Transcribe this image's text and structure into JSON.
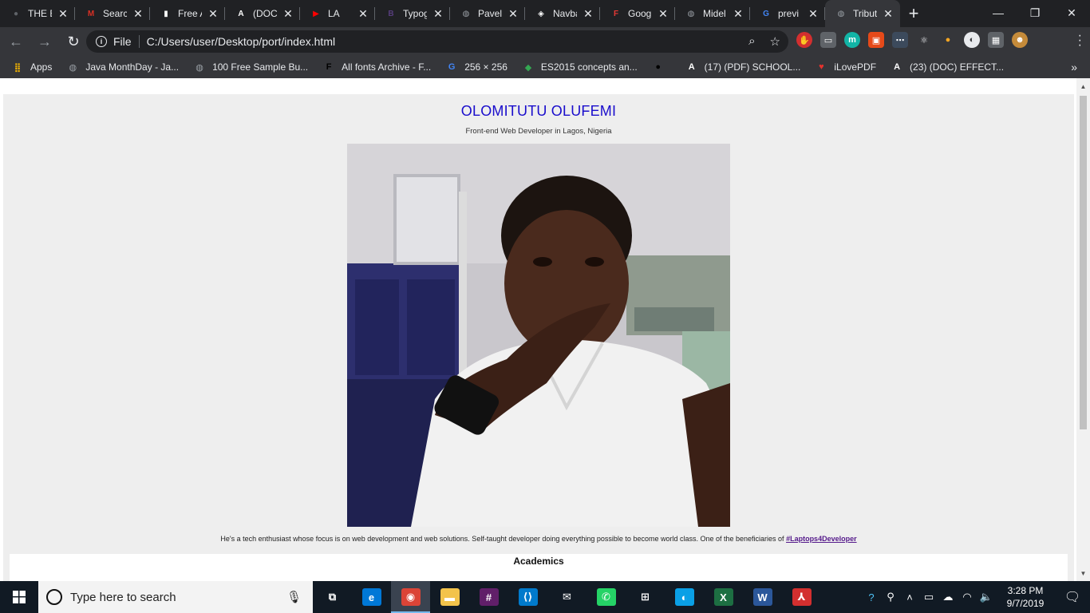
{
  "browser": {
    "tabs": [
      {
        "title": "THE E",
        "fav": "●",
        "color": "#5f6368"
      },
      {
        "title": "Search",
        "fav": "M",
        "color": "#d93025"
      },
      {
        "title": "Free A",
        "fav": "▮",
        "color": "#ffffff"
      },
      {
        "title": "(DOC)",
        "fav": "A",
        "color": "#ffffff"
      },
      {
        "title": "LA",
        "fav": "▶",
        "color": "#ff0000"
      },
      {
        "title": "Typog",
        "fav": "B",
        "color": "#563d7c"
      },
      {
        "title": "Pavel",
        "fav": "◍",
        "color": "#9aa0a6"
      },
      {
        "title": "Navba",
        "fav": "◈",
        "color": "#ffffff"
      },
      {
        "title": "Goog",
        "fav": "F",
        "color": "#e53935"
      },
      {
        "title": "Midel",
        "fav": "◍",
        "color": "#9aa0a6"
      },
      {
        "title": "previ",
        "fav": "G",
        "color": "#4285f4"
      },
      {
        "title": "Tribut",
        "fav": "◍",
        "color": "#9aa0a6"
      }
    ],
    "new_tab_label": "+",
    "window_controls": {
      "minimize": "—",
      "restore": "❐",
      "close": "✕"
    },
    "nav": {
      "back": "←",
      "forward": "→",
      "reload": "↻"
    },
    "address": {
      "scheme": "File",
      "url": "C:/Users/user/Desktop/port/index.html"
    },
    "bookmarks": [
      {
        "label": "Apps",
        "icon": "apps-grid-icon",
        "glyph": "⣿",
        "color": "#f4b400"
      },
      {
        "label": "Java MonthDay - Ja...",
        "icon": "globe-icon",
        "glyph": "◍",
        "color": "#9aa0a6"
      },
      {
        "label": "100 Free Sample Bu...",
        "icon": "globe-icon",
        "glyph": "◍",
        "color": "#9aa0a6"
      },
      {
        "label": "All fonts Archive - F...",
        "icon": "font-f-icon",
        "glyph": "F",
        "color": "#000000"
      },
      {
        "label": "256 × 256",
        "icon": "google-icon",
        "glyph": "G",
        "color": "#4285f4"
      },
      {
        "label": "ES2015 concepts an...",
        "icon": "code-icon",
        "glyph": "◆",
        "color": "#34a853"
      },
      {
        "label": "",
        "icon": "bird-icon",
        "glyph": "●",
        "color": "#000000"
      },
      {
        "label": "(17) (PDF) SCHOOL...",
        "icon": "academia-icon",
        "glyph": "A",
        "color": "#ffffff"
      },
      {
        "label": "iLovePDF",
        "icon": "heart-icon",
        "glyph": "♥",
        "color": "#e5322d"
      },
      {
        "label": "(23) (DOC) EFFECT...",
        "icon": "academia-icon",
        "glyph": "A",
        "color": "#ffffff"
      }
    ],
    "bookmarks_more": "»"
  },
  "page": {
    "name": "OLOMITUTU OLUFEMI",
    "subtitle": "Front-end Web Developer in Lagos, Nigeria",
    "photo_alt": "",
    "bio": "He's a tech enthusiast whose focus is on web development and web solutions. Self-taught developer doing everything possible to become world class. One of the beneficiaries of",
    "bio_link": "#Laptops4Developer",
    "section_title": "Academics",
    "name_color": "#1a0dcc",
    "page_bg": "#eeeeee"
  },
  "taskbar": {
    "search_placeholder": "Type here to search",
    "apps": [
      {
        "name": "task-view-icon",
        "glyph": "⧉",
        "color": "transparent"
      },
      {
        "name": "edge-icon",
        "glyph": "e",
        "color": "#0078d7"
      },
      {
        "name": "chrome-icon",
        "glyph": "◉",
        "color": "#db4437"
      },
      {
        "name": "file-explorer-icon",
        "glyph": "▬",
        "color": "#f3c34b"
      },
      {
        "name": "slack-icon",
        "glyph": "#",
        "color": "#611f69"
      },
      {
        "name": "vscode-icon",
        "glyph": "⟨⟩",
        "color": "#007acc"
      },
      {
        "name": "mail-icon",
        "glyph": "✉",
        "color": "transparent"
      },
      {
        "name": "whatsapp-icon",
        "glyph": "✆",
        "color": "#25d366"
      },
      {
        "name": "store-icon",
        "glyph": "⊞",
        "color": "transparent"
      },
      {
        "name": "app-icon",
        "glyph": "◐",
        "color": "#0aa0e6"
      },
      {
        "name": "excel-icon",
        "glyph": "X",
        "color": "#1d6f42"
      },
      {
        "name": "word-icon",
        "glyph": "W",
        "color": "#2b579a"
      },
      {
        "name": "acrobat-icon",
        "glyph": "⅄",
        "color": "#d32f2f"
      }
    ],
    "time": "3:28 PM",
    "date": "9/7/2019"
  }
}
